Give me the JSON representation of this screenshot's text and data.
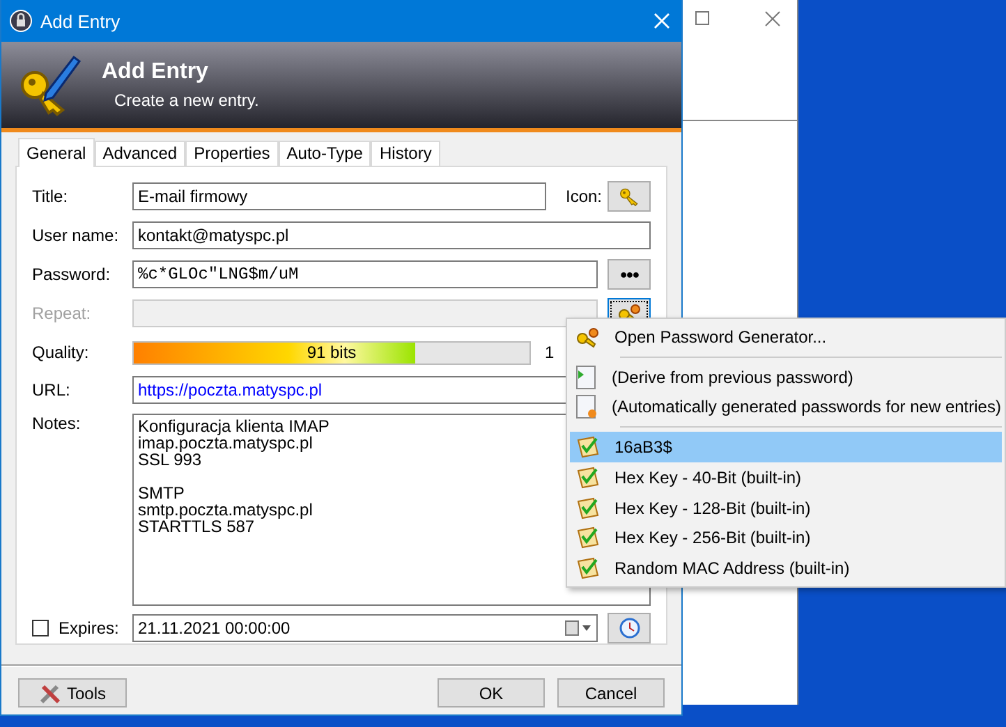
{
  "dialog": {
    "title": "Add Entry",
    "banner": {
      "title": "Add Entry",
      "subtitle": "Create a new entry."
    },
    "tabs": [
      {
        "label": "General",
        "selected": true
      },
      {
        "label": "Advanced",
        "selected": false
      },
      {
        "label": "Properties",
        "selected": false
      },
      {
        "label": "Auto-Type",
        "selected": false
      },
      {
        "label": "History",
        "selected": false
      }
    ],
    "title_field": {
      "label": "Title:",
      "value": "E-mail firmowy",
      "icon_label": "Icon:"
    },
    "username": {
      "label": "User name:",
      "value": "kontakt@matyspc.pl"
    },
    "password": {
      "label": "Password:",
      "value": "%c*GLOc\"LNG$m/uM",
      "button": "●●●"
    },
    "repeat": {
      "label": "Repeat:",
      "disabled": true
    },
    "quality": {
      "label": "Quality:",
      "level": 0.71,
      "reading": "91 bits",
      "length": "1"
    },
    "url": {
      "label": "URL:",
      "value": "https://poczta.matyspc.pl"
    },
    "notes": {
      "label": "Notes:",
      "blocks": [
        [
          "Konfiguracja klienta IMAP",
          "imap.poczta.matyspc.pl",
          "SSL 993"
        ],
        [
          "SMTP",
          "smtp.poczta.matyspc.pl",
          "STARTTLS 587"
        ]
      ]
    },
    "expires": {
      "label": "Expires:",
      "checked": false,
      "value": "21.11.2021 00:00:00"
    },
    "buttons": {
      "tools": "Tools",
      "ok": "OK",
      "cancel": "Cancel"
    }
  },
  "menu": {
    "groups": [
      [
        {
          "kind": "generator",
          "label": "Open Password Generator...",
          "selected": false
        }
      ],
      [
        {
          "kind": "derive",
          "label": "(Derive from previous password)",
          "selected": false
        },
        {
          "kind": "auto",
          "label": "(Automatically generated passwords for new entries)",
          "selected": false
        }
      ],
      [
        {
          "kind": "profile",
          "label": "16aB3$",
          "selected": true
        },
        {
          "kind": "profile",
          "label": "Hex Key - 40-Bit (built-in)",
          "selected": false
        },
        {
          "kind": "profile",
          "label": "Hex Key - 128-Bit (built-in)",
          "selected": false
        },
        {
          "kind": "profile",
          "label": "Hex Key - 256-Bit (built-in)",
          "selected": false
        },
        {
          "kind": "profile",
          "label": "Random MAC Address (built-in)",
          "selected": false
        }
      ]
    ]
  }
}
